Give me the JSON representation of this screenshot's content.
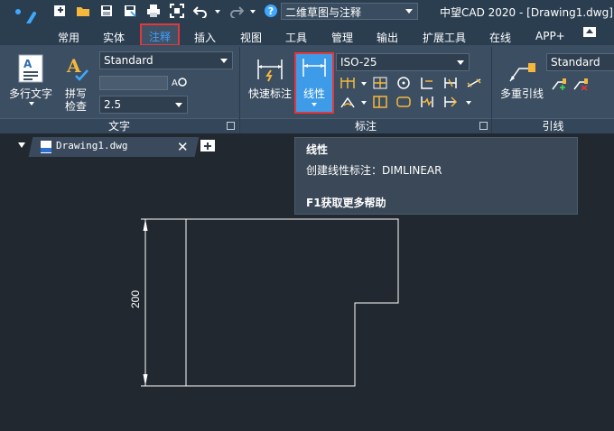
{
  "titlebar": {
    "workspace": "二维草图与注释",
    "app_title": "中望CAD 2020 - [Drawing1.dwg]",
    "quick_access_icons": [
      "new-icon",
      "open-icon",
      "save-icon",
      "save-as-icon",
      "print-icon",
      "zoom-extents-icon",
      "undo-icon",
      "redo-icon",
      "help-icon"
    ]
  },
  "menu": {
    "tabs": [
      "常用",
      "实体",
      "注释",
      "插入",
      "视图",
      "工具",
      "管理",
      "输出",
      "扩展工具",
      "在线",
      "APP+"
    ],
    "active": "注释"
  },
  "ribbon": {
    "text_panel": {
      "title": "文字",
      "mtext_label": "多行文字",
      "spell_label_1": "拼写",
      "spell_label_2": "检查",
      "style_value": "Standard",
      "height_value": "2.5"
    },
    "dim_panel": {
      "title": "标注",
      "quick_dim_label": "快速标注",
      "linear_label": "线性",
      "dimstyle_value": "ISO-25"
    },
    "leader_panel": {
      "title": "引线",
      "mleader_label": "多重引线",
      "style_value": "Standard"
    }
  },
  "document": {
    "tab_label": "Drawing1.dwg"
  },
  "tooltip": {
    "title": "线性",
    "description": "创建线性标注：DIMLINEAR",
    "help": "F1获取更多帮助"
  },
  "drawing": {
    "dimension_text": "200"
  },
  "colors": {
    "canvas": "#212830",
    "ribbon": "#3c4e61",
    "highlight": "#3e9be8",
    "callout_border": "#e0393d"
  }
}
